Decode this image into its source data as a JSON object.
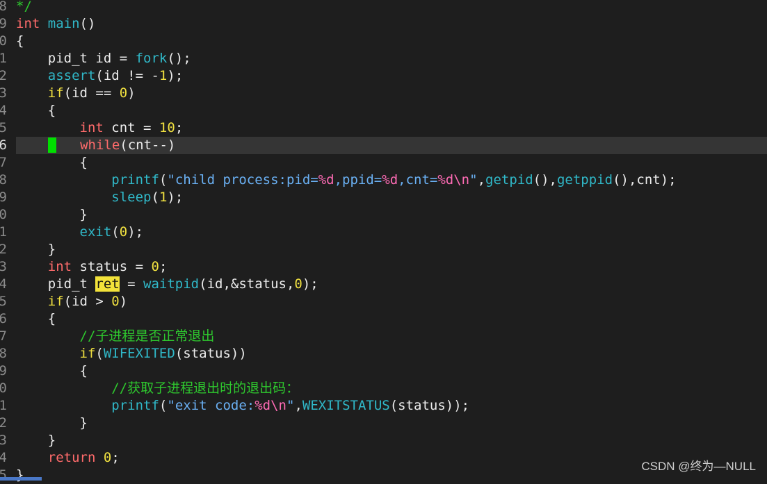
{
  "watermark": "CSDN @终为—NULL",
  "colors": {
    "background": "#1e1e1e",
    "current_line": "#353535",
    "keyword": "#f0e040",
    "type": "#ff6b6b",
    "function": "#30b8c8",
    "string": "#6ab0f3",
    "format": "#ff6bb5",
    "comment": "#2ec82e",
    "cursor": "#00e000",
    "search_highlight": "#f2e23a"
  },
  "lines": [
    {
      "num": "8",
      "tokens": [
        {
          "t": "*/",
          "c": "cmt"
        }
      ]
    },
    {
      "num": "9",
      "tokens": [
        {
          "t": "int",
          "c": "type"
        },
        {
          "t": " ",
          "c": "plain"
        },
        {
          "t": "main",
          "c": "fn"
        },
        {
          "t": "()",
          "c": "plain"
        }
      ]
    },
    {
      "num": "0",
      "tokens": [
        {
          "t": "{",
          "c": "plain"
        }
      ]
    },
    {
      "num": "1",
      "tokens": [
        {
          "t": "    pid_t id = ",
          "c": "plain"
        },
        {
          "t": "fork",
          "c": "fn"
        },
        {
          "t": "();",
          "c": "plain"
        }
      ]
    },
    {
      "num": "2",
      "tokens": [
        {
          "t": "    ",
          "c": "plain"
        },
        {
          "t": "assert",
          "c": "fn"
        },
        {
          "t": "(id != -",
          "c": "plain"
        },
        {
          "t": "1",
          "c": "num"
        },
        {
          "t": ");",
          "c": "plain"
        }
      ]
    },
    {
      "num": "3",
      "tokens": [
        {
          "t": "    ",
          "c": "plain"
        },
        {
          "t": "if",
          "c": "kw"
        },
        {
          "t": "(id == ",
          "c": "plain"
        },
        {
          "t": "0",
          "c": "num"
        },
        {
          "t": ")",
          "c": "plain"
        }
      ]
    },
    {
      "num": "4",
      "tokens": [
        {
          "t": "    {",
          "c": "plain"
        }
      ]
    },
    {
      "num": "5",
      "tokens": [
        {
          "t": "        ",
          "c": "plain"
        },
        {
          "t": "int",
          "c": "type"
        },
        {
          "t": " cnt = ",
          "c": "plain"
        },
        {
          "t": "10",
          "c": "num"
        },
        {
          "t": ";",
          "c": "plain"
        }
      ]
    },
    {
      "num": "6",
      "current": true,
      "tokens": [
        {
          "t": "    ",
          "c": "plain"
        },
        {
          "t": "",
          "c": "cursor"
        },
        {
          "t": "   ",
          "c": "plain"
        },
        {
          "t": "while",
          "c": "type"
        },
        {
          "t": "(cnt--)",
          "c": "plain"
        }
      ]
    },
    {
      "num": "7",
      "tokens": [
        {
          "t": "        {",
          "c": "plain"
        }
      ]
    },
    {
      "num": "8",
      "tokens": [
        {
          "t": "            ",
          "c": "plain"
        },
        {
          "t": "printf",
          "c": "fn"
        },
        {
          "t": "(",
          "c": "plain"
        },
        {
          "t": "\"child process:pid=",
          "c": "str"
        },
        {
          "t": "%d",
          "c": "fmt"
        },
        {
          "t": ",ppid=",
          "c": "str"
        },
        {
          "t": "%d",
          "c": "fmt"
        },
        {
          "t": ",cnt=",
          "c": "str"
        },
        {
          "t": "%d\\n",
          "c": "fmt"
        },
        {
          "t": "\"",
          "c": "str"
        },
        {
          "t": ",",
          "c": "plain"
        },
        {
          "t": "getpid",
          "c": "fn"
        },
        {
          "t": "(),",
          "c": "plain"
        },
        {
          "t": "getppid",
          "c": "fn"
        },
        {
          "t": "(),cnt);",
          "c": "plain"
        }
      ]
    },
    {
      "num": "9",
      "tokens": [
        {
          "t": "            ",
          "c": "plain"
        },
        {
          "t": "sleep",
          "c": "fn"
        },
        {
          "t": "(",
          "c": "plain"
        },
        {
          "t": "1",
          "c": "num"
        },
        {
          "t": ");",
          "c": "plain"
        }
      ]
    },
    {
      "num": "0",
      "tokens": [
        {
          "t": "        }",
          "c": "plain"
        }
      ]
    },
    {
      "num": "1",
      "tokens": [
        {
          "t": "        ",
          "c": "plain"
        },
        {
          "t": "exit",
          "c": "fn"
        },
        {
          "t": "(",
          "c": "plain"
        },
        {
          "t": "0",
          "c": "num"
        },
        {
          "t": ");",
          "c": "plain"
        }
      ]
    },
    {
      "num": "2",
      "tokens": [
        {
          "t": "    }",
          "c": "plain"
        }
      ]
    },
    {
      "num": "3",
      "tokens": [
        {
          "t": "    ",
          "c": "plain"
        },
        {
          "t": "int",
          "c": "type"
        },
        {
          "t": " status = ",
          "c": "plain"
        },
        {
          "t": "0",
          "c": "num"
        },
        {
          "t": ";",
          "c": "plain"
        }
      ]
    },
    {
      "num": "4",
      "tokens": [
        {
          "t": "    pid_t ",
          "c": "plain"
        },
        {
          "t": "ret",
          "c": "hl"
        },
        {
          "t": " = ",
          "c": "plain"
        },
        {
          "t": "waitpid",
          "c": "fn"
        },
        {
          "t": "(id,&status,",
          "c": "plain"
        },
        {
          "t": "0",
          "c": "num"
        },
        {
          "t": ");",
          "c": "plain"
        }
      ]
    },
    {
      "num": "5",
      "tokens": [
        {
          "t": "    ",
          "c": "plain"
        },
        {
          "t": "if",
          "c": "kw"
        },
        {
          "t": "(id > ",
          "c": "plain"
        },
        {
          "t": "0",
          "c": "num"
        },
        {
          "t": ")",
          "c": "plain"
        }
      ]
    },
    {
      "num": "6",
      "tokens": [
        {
          "t": "    {",
          "c": "plain"
        }
      ]
    },
    {
      "num": "7",
      "tokens": [
        {
          "t": "        ",
          "c": "plain"
        },
        {
          "t": "//子进程是否正常退出",
          "c": "cmt"
        }
      ]
    },
    {
      "num": "8",
      "tokens": [
        {
          "t": "        ",
          "c": "plain"
        },
        {
          "t": "if",
          "c": "kw"
        },
        {
          "t": "(",
          "c": "plain"
        },
        {
          "t": "WIFEXITED",
          "c": "fn"
        },
        {
          "t": "(status))",
          "c": "plain"
        }
      ]
    },
    {
      "num": "9",
      "tokens": [
        {
          "t": "        {",
          "c": "plain"
        }
      ]
    },
    {
      "num": "0",
      "tokens": [
        {
          "t": "            ",
          "c": "plain"
        },
        {
          "t": "//获取子进程退出时的退出码：",
          "c": "cmt"
        }
      ]
    },
    {
      "num": "1",
      "tokens": [
        {
          "t": "            ",
          "c": "plain"
        },
        {
          "t": "printf",
          "c": "fn"
        },
        {
          "t": "(",
          "c": "plain"
        },
        {
          "t": "\"exit code:",
          "c": "str"
        },
        {
          "t": "%d\\n",
          "c": "fmt"
        },
        {
          "t": "\"",
          "c": "str"
        },
        {
          "t": ",",
          "c": "plain"
        },
        {
          "t": "WEXITSTATUS",
          "c": "fn"
        },
        {
          "t": "(status));",
          "c": "plain"
        }
      ]
    },
    {
      "num": "2",
      "tokens": [
        {
          "t": "        }",
          "c": "plain"
        }
      ]
    },
    {
      "num": "3",
      "tokens": [
        {
          "t": "    }",
          "c": "plain"
        }
      ]
    },
    {
      "num": "4",
      "tokens": [
        {
          "t": "    ",
          "c": "plain"
        },
        {
          "t": "return",
          "c": "type"
        },
        {
          "t": " ",
          "c": "plain"
        },
        {
          "t": "0",
          "c": "num"
        },
        {
          "t": ";",
          "c": "plain"
        }
      ]
    },
    {
      "num": "5",
      "tokens": [
        {
          "t": "}",
          "c": "plain"
        }
      ]
    }
  ]
}
